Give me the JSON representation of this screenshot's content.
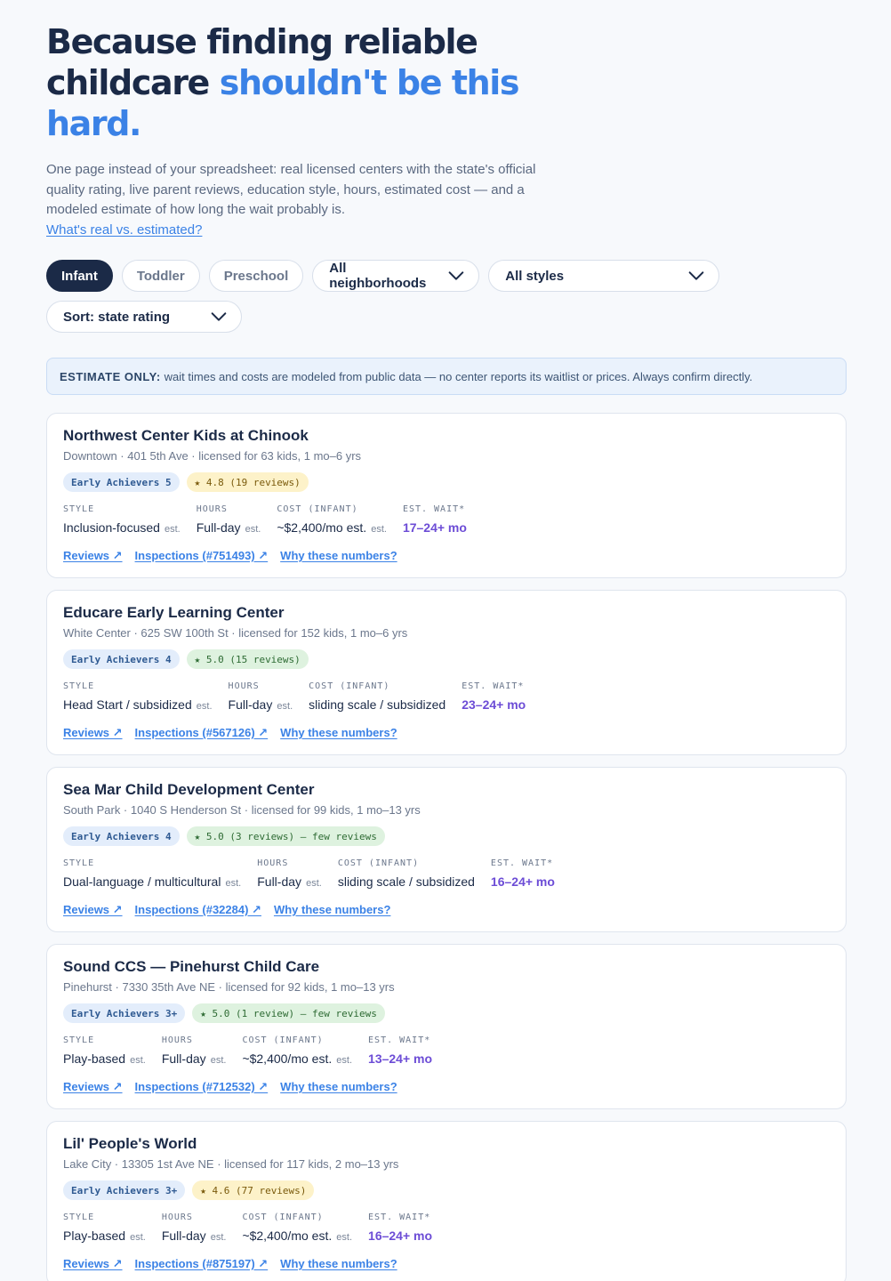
{
  "hero": {
    "headline_main": "Because finding reliable childcare ",
    "headline_accent": "shouldn't be this hard.",
    "intro": "One page instead of your spreadsheet: real licensed centers with the state's official quality rating, live parent reviews, education style, hours, estimated cost — and a modeled estimate of how long the wait probably is.",
    "intro_link": "What's real vs. estimated?"
  },
  "filters": {
    "age_tabs": [
      {
        "label": "Infant",
        "active": true
      },
      {
        "label": "Toddler",
        "active": false
      },
      {
        "label": "Preschool",
        "active": false
      }
    ],
    "neighborhood": "All neighborhoods",
    "style": "All styles",
    "sort": "Sort: state rating"
  },
  "notice": {
    "strong": "ESTIMATE ONLY:",
    "text": "wait times and costs are modeled from public data — no center reports its waitlist or prices. Always confirm directly."
  },
  "labels": {
    "style": "STYLE",
    "hours": "HOURS",
    "cost": "COST (INFANT)",
    "wait": "EST. WAIT*",
    "est": "est.",
    "reviews_link": "Reviews ↗",
    "why_link": "Why these numbers?"
  },
  "colors": {
    "navy": "#1b2a47",
    "accent": "#3b82e6",
    "wait_purple": "#6c4cd6",
    "rating_yellow": "#fdf2c9",
    "rating_green": "#def2df"
  },
  "centers": [
    {
      "name": "Northwest Center Kids at Chinook",
      "sub": "Downtown · 401 5th Ave · licensed for 63 kids, 1 mo–6 yrs",
      "ea": "Early Achievers 5",
      "rating": "★ 4.8 (19 reviews)",
      "rating_color": "yellow",
      "style": "Inclusion-focused",
      "style_est": true,
      "hours": "Full-day",
      "cost": "~$2,400/mo est.",
      "cost_est": true,
      "wait": "17–24+ mo",
      "inspections": "Inspections (#751493) ↗"
    },
    {
      "name": "Educare Early Learning Center",
      "sub": "White Center · 625 SW 100th St · licensed for 152 kids, 1 mo–6 yrs",
      "ea": "Early Achievers 4",
      "rating": "★ 5.0 (15 reviews)",
      "rating_color": "green",
      "style": "Head Start / subsidized",
      "style_est": true,
      "hours": "Full-day",
      "cost": "sliding scale / subsidized",
      "cost_est": false,
      "wait": "23–24+ mo",
      "inspections": "Inspections (#567126) ↗"
    },
    {
      "name": "Sea Mar Child Development Center",
      "sub": "South Park · 1040 S Henderson St · licensed for 99 kids, 1 mo–13 yrs",
      "ea": "Early Achievers 4",
      "rating": "★ 5.0 (3 reviews) — few reviews",
      "rating_color": "green",
      "style": "Dual-language / multicultural",
      "style_est": true,
      "hours": "Full-day",
      "cost": "sliding scale / subsidized",
      "cost_est": false,
      "wait": "16–24+ mo",
      "inspections": "Inspections (#32284) ↗"
    },
    {
      "name": "Sound CCS — Pinehurst Child Care",
      "sub": "Pinehurst · 7330 35th Ave NE · licensed for 92 kids, 1 mo–13 yrs",
      "ea": "Early Achievers 3+",
      "rating": "★ 5.0 (1 review) — few reviews",
      "rating_color": "green",
      "style": "Play-based",
      "style_est": true,
      "hours": "Full-day",
      "cost": "~$2,400/mo est.",
      "cost_est": true,
      "wait": "13–24+ mo",
      "inspections": "Inspections (#712532) ↗"
    },
    {
      "name": "Lil' People's World",
      "sub": "Lake City · 13305 1st Ave NE · licensed for 117 kids, 2 mo–13 yrs",
      "ea": "Early Achievers 3+",
      "rating": "★ 4.6 (77 reviews)",
      "rating_color": "yellow",
      "style": "Play-based",
      "style_est": true,
      "hours": "Full-day",
      "cost": "~$2,400/mo est.",
      "cost_est": true,
      "wait": "16–24+ mo",
      "inspections": "Inspections (#875197) ↗"
    }
  ]
}
